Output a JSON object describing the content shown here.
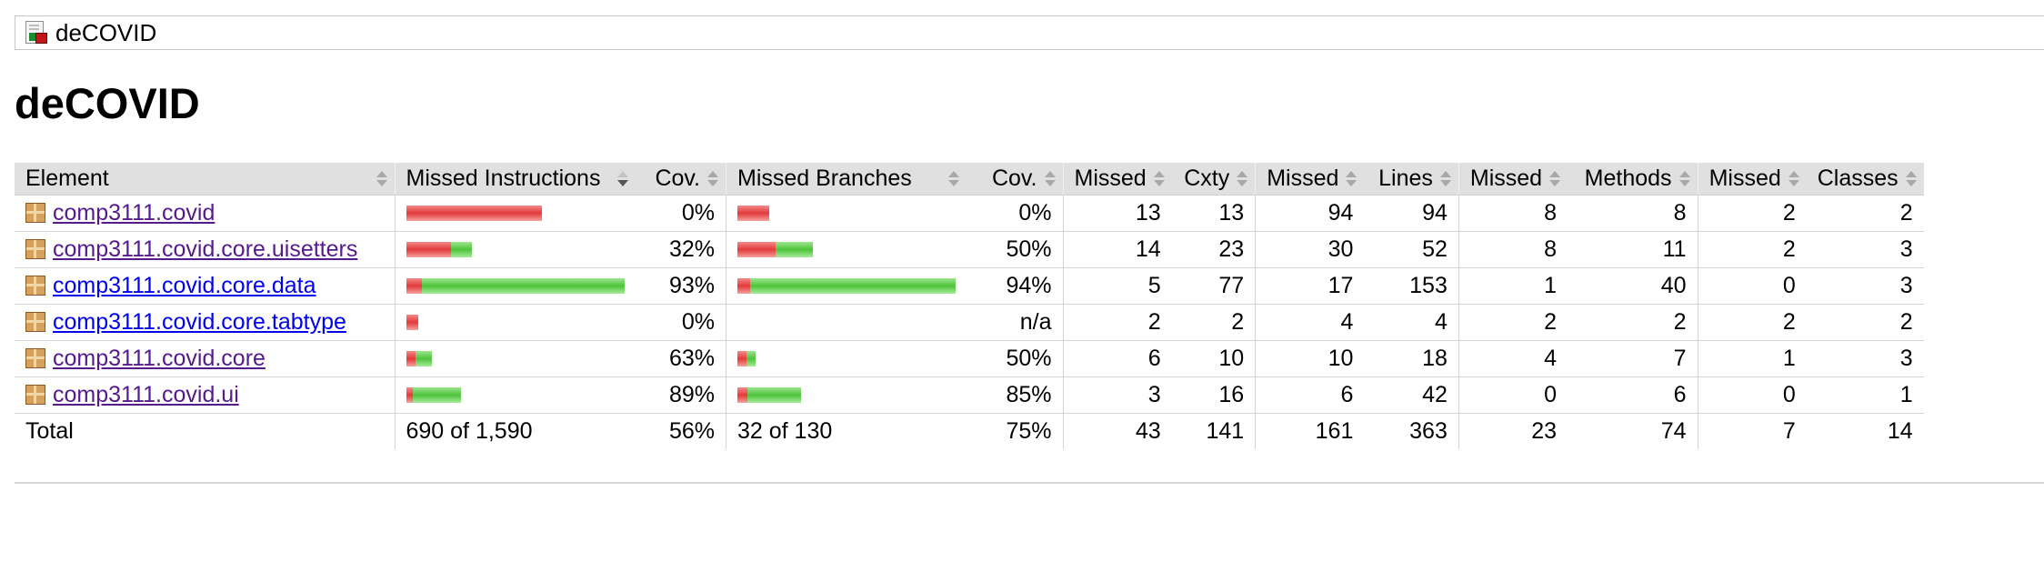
{
  "breadcrumb": {
    "title": "deCOVID"
  },
  "page_title": "deCOVID",
  "table": {
    "headers": [
      "Element",
      "Missed Instructions",
      "Cov.",
      "Missed Branches",
      "Cov.",
      "Missed",
      "Cxty",
      "Missed",
      "Lines",
      "Missed",
      "Methods",
      "Missed",
      "Classes"
    ],
    "rows": [
      {
        "name": "comp3111.covid",
        "visited": true,
        "instr_missed_pct": 100,
        "instr_cov": "0%",
        "branch_missed_pct": 100,
        "branch_cov": "0%",
        "branch_bar": true,
        "cxty_missed": "13",
        "cxty": "13",
        "lines_missed": "94",
        "lines": "94",
        "methods_missed": "8",
        "methods": "8",
        "classes_missed": "2",
        "classes": "2",
        "instr_bar_scale": 0.62,
        "branch_bar_scale": 0.145
      },
      {
        "name": "comp3111.covid.core.uisetters",
        "visited": true,
        "instr_missed_pct": 68,
        "instr_cov": "32%",
        "branch_missed_pct": 50,
        "branch_cov": "50%",
        "branch_bar": true,
        "cxty_missed": "14",
        "cxty": "23",
        "lines_missed": "30",
        "lines": "52",
        "methods_missed": "8",
        "methods": "11",
        "classes_missed": "2",
        "classes": "3",
        "instr_bar_scale": 0.3,
        "branch_bar_scale": 0.345
      },
      {
        "name": "comp3111.covid.core.data",
        "visited": false,
        "instr_missed_pct": 7,
        "instr_cov": "93%",
        "branch_missed_pct": 6,
        "branch_cov": "94%",
        "branch_bar": true,
        "cxty_missed": "5",
        "cxty": "77",
        "lines_missed": "17",
        "lines": "153",
        "methods_missed": "1",
        "methods": "40",
        "classes_missed": "0",
        "classes": "3",
        "instr_bar_scale": 1.0,
        "branch_bar_scale": 1.0
      },
      {
        "name": "comp3111.covid.core.tabtype",
        "visited": false,
        "instr_missed_pct": 100,
        "instr_cov": "0%",
        "branch_missed_pct": 0,
        "branch_cov": "n/a",
        "branch_bar": false,
        "cxty_missed": "2",
        "cxty": "2",
        "lines_missed": "4",
        "lines": "4",
        "methods_missed": "2",
        "methods": "2",
        "classes_missed": "2",
        "classes": "2",
        "instr_bar_scale": 0.055,
        "branch_bar_scale": 0
      },
      {
        "name": "comp3111.covid.core",
        "visited": true,
        "instr_missed_pct": 37,
        "instr_cov": "63%",
        "branch_missed_pct": 50,
        "branch_cov": "50%",
        "branch_bar": true,
        "cxty_missed": "6",
        "cxty": "10",
        "lines_missed": "10",
        "lines": "18",
        "methods_missed": "4",
        "methods": "7",
        "classes_missed": "1",
        "classes": "3",
        "instr_bar_scale": 0.115,
        "branch_bar_scale": 0.085
      },
      {
        "name": "comp3111.covid.ui",
        "visited": true,
        "instr_missed_pct": 11,
        "instr_cov": "89%",
        "branch_missed_pct": 15,
        "branch_cov": "85%",
        "branch_bar": true,
        "cxty_missed": "3",
        "cxty": "16",
        "lines_missed": "6",
        "lines": "42",
        "methods_missed": "0",
        "methods": "6",
        "classes_missed": "0",
        "classes": "1",
        "instr_bar_scale": 0.25,
        "branch_bar_scale": 0.29
      }
    ],
    "total": {
      "label": "Total",
      "instr": "690 of 1,590",
      "instr_cov": "56%",
      "branch": "32 of 130",
      "branch_cov": "75%",
      "cxty_missed": "43",
      "cxty": "141",
      "lines_missed": "161",
      "lines": "363",
      "methods_missed": "23",
      "methods": "74",
      "classes_missed": "7",
      "classes": "14"
    }
  }
}
